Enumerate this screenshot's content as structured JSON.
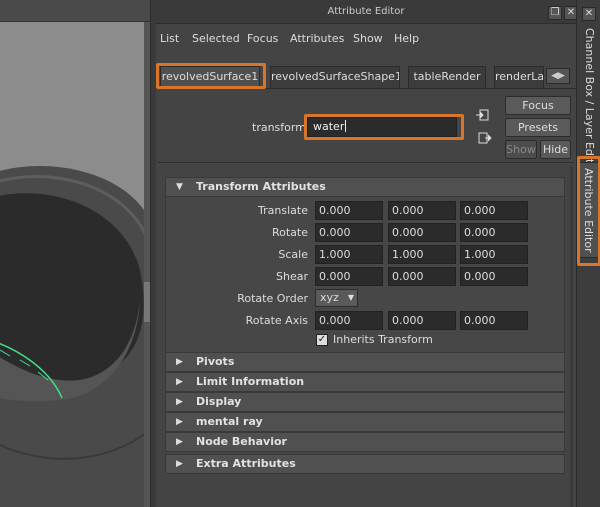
{
  "window": {
    "title": "Attribute Editor"
  },
  "menubar": [
    "List",
    "Selected",
    "Focus",
    "Attributes",
    "Show",
    "Help"
  ],
  "tabs": [
    "revolvedSurface1",
    "revolvedSurfaceShape1",
    "tableRender",
    "renderLa"
  ],
  "transform": {
    "label": "transform:",
    "value": "water"
  },
  "buttons": {
    "focus": "Focus",
    "presets": "Presets",
    "show": "Show",
    "hide": "Hide"
  },
  "sections": {
    "transform_attributes": "Transform Attributes",
    "collapsed": [
      "Pivots",
      "Limit Information",
      "Display",
      "mental ray",
      "Node Behavior",
      "Extra Attributes"
    ]
  },
  "attributes": {
    "translate": {
      "label": "Translate",
      "values": [
        "0.000",
        "0.000",
        "0.000"
      ]
    },
    "rotate": {
      "label": "Rotate",
      "values": [
        "0.000",
        "0.000",
        "0.000"
      ]
    },
    "scale": {
      "label": "Scale",
      "values": [
        "1.000",
        "1.000",
        "1.000"
      ]
    },
    "shear": {
      "label": "Shear",
      "values": [
        "0.000",
        "0.000",
        "0.000"
      ]
    },
    "rotate_order": {
      "label": "Rotate Order",
      "value": "xyz"
    },
    "rotate_axis": {
      "label": "Rotate Axis",
      "values": [
        "0.000",
        "0.000",
        "0.000"
      ]
    },
    "inherits_transform": {
      "label": "Inherits Transform",
      "checked": true
    }
  },
  "dock_tabs": [
    "Channel Box / Layer Editor",
    "Attribute Editor"
  ],
  "colors": {
    "highlight": "#d9752a",
    "panel": "#444444",
    "field": "#2b2b2b"
  }
}
